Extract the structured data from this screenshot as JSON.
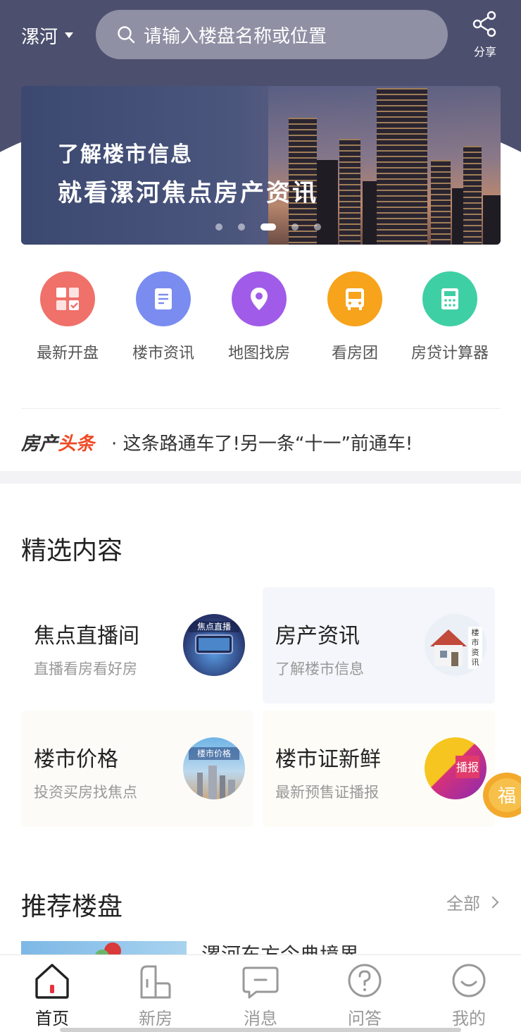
{
  "header": {
    "city": "漯河",
    "search_placeholder": "请输入楼盘名称或位置",
    "share_label": "分享"
  },
  "banner": {
    "line1": "了解楼市信息",
    "line2": "就看漯河焦点房产资讯",
    "slide_count": 5,
    "active_slide": 3
  },
  "quick_nav": [
    {
      "label": "最新开盘",
      "icon": "calendar-grid-icon",
      "color": "#f0706a"
    },
    {
      "label": "楼市资讯",
      "icon": "document-icon",
      "color": "#7b8cf0"
    },
    {
      "label": "地图找房",
      "icon": "map-pin-icon",
      "color": "#a05ce8"
    },
    {
      "label": "看房团",
      "icon": "bus-icon",
      "color": "#f7a31b"
    },
    {
      "label": "房贷计算器",
      "icon": "calculator-icon",
      "color": "#3fcfa4"
    }
  ],
  "headline": {
    "brand_a": "房产",
    "brand_b": "头条",
    "text": "· 这条路通车了!另一条“十一”前通车!"
  },
  "featured": {
    "title": "精选内容",
    "cards": [
      {
        "title": "焦点直播间",
        "subtitle": "直播看房看好房",
        "thumb_text": "焦点直播",
        "bg": "#ffffff"
      },
      {
        "title": "房产资讯",
        "subtitle": "了解楼市信息",
        "thumb_text": "楼市资讯",
        "bg": "#f5f6fb"
      },
      {
        "title": "楼市价格",
        "subtitle": "投资买房找焦点",
        "thumb_text": "楼市价格",
        "bg": "#fdfbf8"
      },
      {
        "title": "楼市证新鲜",
        "subtitle": "最新预售证播报",
        "thumb_text": "播报",
        "bg": "#fdfcf7"
      }
    ]
  },
  "recommend": {
    "title": "推荐楼盘",
    "more_label": "全部",
    "first_item_name": "漯河东方今典境界"
  },
  "floating": {
    "fu_char": "福"
  },
  "tabbar": [
    {
      "label": "首页",
      "icon": "home-icon",
      "active": true
    },
    {
      "label": "新房",
      "icon": "building-icon",
      "active": false
    },
    {
      "label": "消息",
      "icon": "message-icon",
      "active": false
    },
    {
      "label": "问答",
      "icon": "question-icon",
      "active": false
    },
    {
      "label": "我的",
      "icon": "smile-icon",
      "active": false
    }
  ]
}
